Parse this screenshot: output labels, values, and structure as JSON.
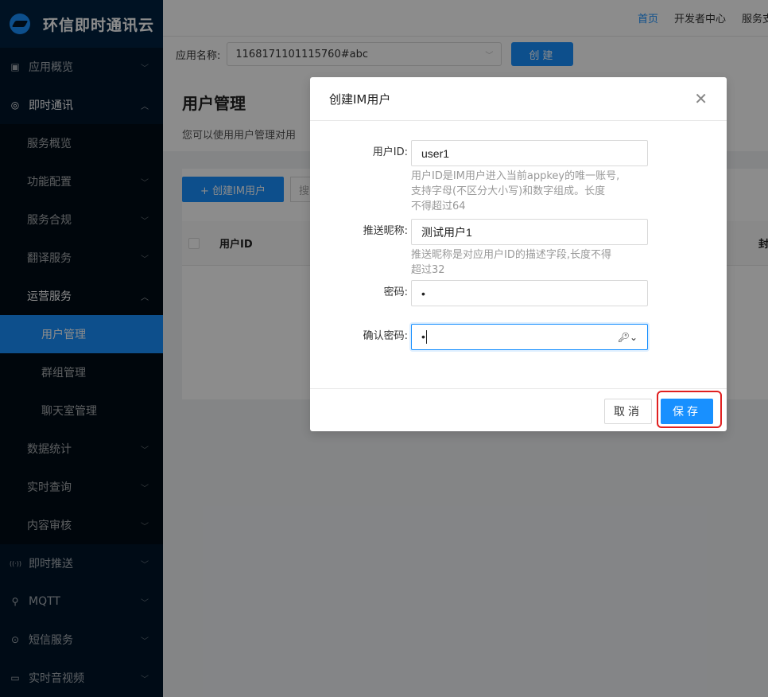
{
  "brand": {
    "name": "环信即时通讯云",
    "logo_icon": "hyphenate-logo-icon"
  },
  "header": {
    "nav": [
      "首页",
      "开发者中心",
      "服务支"
    ]
  },
  "app_bar": {
    "label": "应用名称:",
    "selected_app": "1168171101115760#abc",
    "create_label": "创建"
  },
  "sidebar": {
    "items": [
      {
        "label": "应用概览",
        "icon": "overview-icon",
        "level": 1,
        "arrow": "down"
      },
      {
        "label": "即时通讯",
        "icon": "chat-icon",
        "level": 1,
        "arrow": "up",
        "bright": true
      },
      {
        "label": "服务概览",
        "level": 2
      },
      {
        "label": "功能配置",
        "level": 2,
        "arrow": "down"
      },
      {
        "label": "服务合规",
        "level": 2,
        "arrow": "down"
      },
      {
        "label": "翻译服务",
        "level": 2,
        "arrow": "down"
      },
      {
        "label": "运营服务",
        "level": 2,
        "arrow": "up",
        "bright": true
      },
      {
        "label": "用户管理",
        "level": 3,
        "active": true
      },
      {
        "label": "群组管理",
        "level": 3
      },
      {
        "label": "聊天室管理",
        "level": 3
      },
      {
        "label": "数据统计",
        "level": 2,
        "arrow": "down"
      },
      {
        "label": "实时查询",
        "level": 2,
        "arrow": "down"
      },
      {
        "label": "内容审核",
        "level": 2,
        "arrow": "down"
      },
      {
        "label": "即时推送",
        "icon": "push-icon",
        "level": 1,
        "arrow": "down"
      },
      {
        "label": "MQTT",
        "icon": "mqtt-icon",
        "level": 1,
        "arrow": "down"
      },
      {
        "label": "短信服务",
        "icon": "sms-icon",
        "level": 1,
        "arrow": "down"
      },
      {
        "label": "实时音视频",
        "icon": "video-icon",
        "level": 1,
        "arrow": "down"
      }
    ]
  },
  "page": {
    "title": "用户管理",
    "description": "您可以使用用户管理对用",
    "add_user_label": "+ 创建IM用户",
    "search_stub": "搜",
    "table_headers": {
      "user_id": "用户ID",
      "right_col": "封"
    }
  },
  "modal": {
    "title": "创建IM用户",
    "fields": {
      "user_id": {
        "label": "用户ID:",
        "value": "user1",
        "hint_lines": [
          "用户ID是IM用户进入当前appkey的唯一账号,",
          "支持字母(不区分大小写)和数字组成。长度",
          "不得超过64"
        ]
      },
      "nickname": {
        "label": "推送昵称:",
        "value": "测试用户1",
        "hint_lines": [
          "推送昵称是对应用户ID的描述字段,长度不得",
          "超过32"
        ]
      },
      "password": {
        "label": "密码:",
        "value": "•"
      },
      "confirm_password": {
        "label": "确认密码:",
        "value": "•"
      }
    },
    "cancel_label": "取消",
    "save_label": "保存"
  },
  "colors": {
    "primary": "#1890ff",
    "sidebar_bg": "#001529",
    "highlight": "#e02020"
  }
}
